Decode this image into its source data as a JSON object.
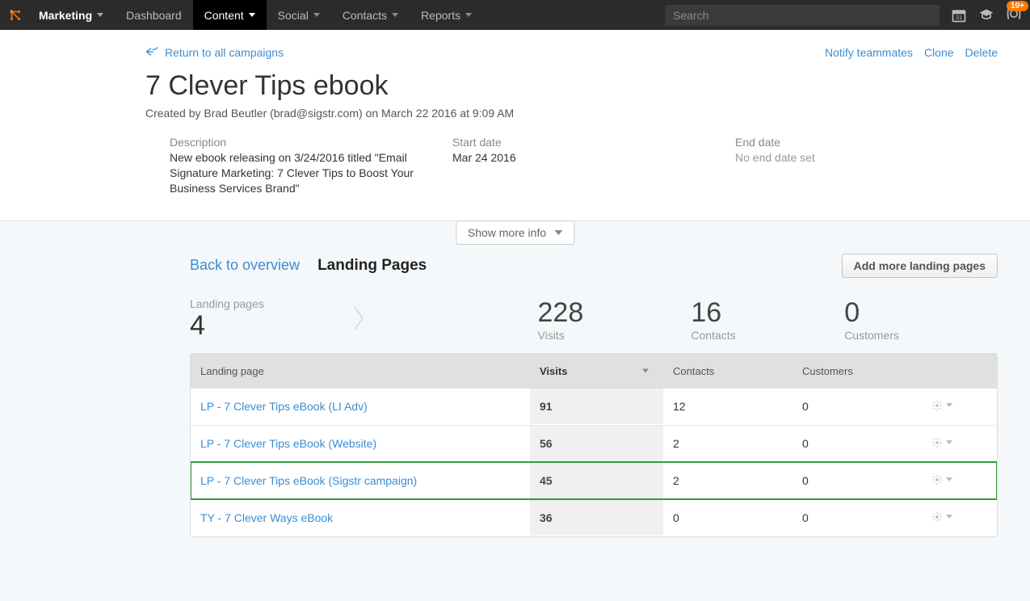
{
  "nav": {
    "brand": "Marketing",
    "items": [
      "Dashboard",
      "Content",
      "Social",
      "Contacts",
      "Reports"
    ],
    "active_index": 1,
    "search_placeholder": "Search",
    "notif_count": "10+",
    "calendar_day": "31"
  },
  "header": {
    "back_label": "Return to all campaigns",
    "title": "7 Clever Tips ebook",
    "created_by": "Created by Brad Beutler (brad@sigstr.com) on March 22 2016 at 9:09 AM",
    "description_label": "Description",
    "description": "New ebook releasing on 3/24/2016 titled \"Email Signature Marketing: 7 Clever Tips to Boost Your Business Services Brand\"",
    "start_label": "Start date",
    "start_date": "Mar 24 2016",
    "end_label": "End date",
    "end_date": "No end date set",
    "actions": {
      "notify": "Notify teammates",
      "clone": "Clone",
      "delete": "Delete"
    },
    "show_more": "Show more info"
  },
  "overview": {
    "back_link": "Back to overview",
    "title": "Landing Pages",
    "add_button": "Add more landing pages",
    "lp_label": "Landing pages",
    "lp_count": "4",
    "visits_label": "Visits",
    "visits": "228",
    "contacts_label": "Contacts",
    "contacts": "16",
    "customers_label": "Customers",
    "customers": "0"
  },
  "table": {
    "columns": {
      "name": "Landing page",
      "visits": "Visits",
      "contacts": "Contacts",
      "customers": "Customers"
    },
    "rows": [
      {
        "name": "LP - 7 Clever Tips eBook (LI Adv)",
        "visits": "91",
        "contacts": "12",
        "customers": "0",
        "highlight": false
      },
      {
        "name": "LP - 7 Clever Tips eBook (Website)",
        "visits": "56",
        "contacts": "2",
        "customers": "0",
        "highlight": false
      },
      {
        "name": "LP - 7 Clever Tips eBook (Sigstr campaign)",
        "visits": "45",
        "contacts": "2",
        "customers": "0",
        "highlight": true
      },
      {
        "name": "TY - 7 Clever Ways eBook",
        "visits": "36",
        "contacts": "0",
        "customers": "0",
        "highlight": false
      }
    ]
  }
}
